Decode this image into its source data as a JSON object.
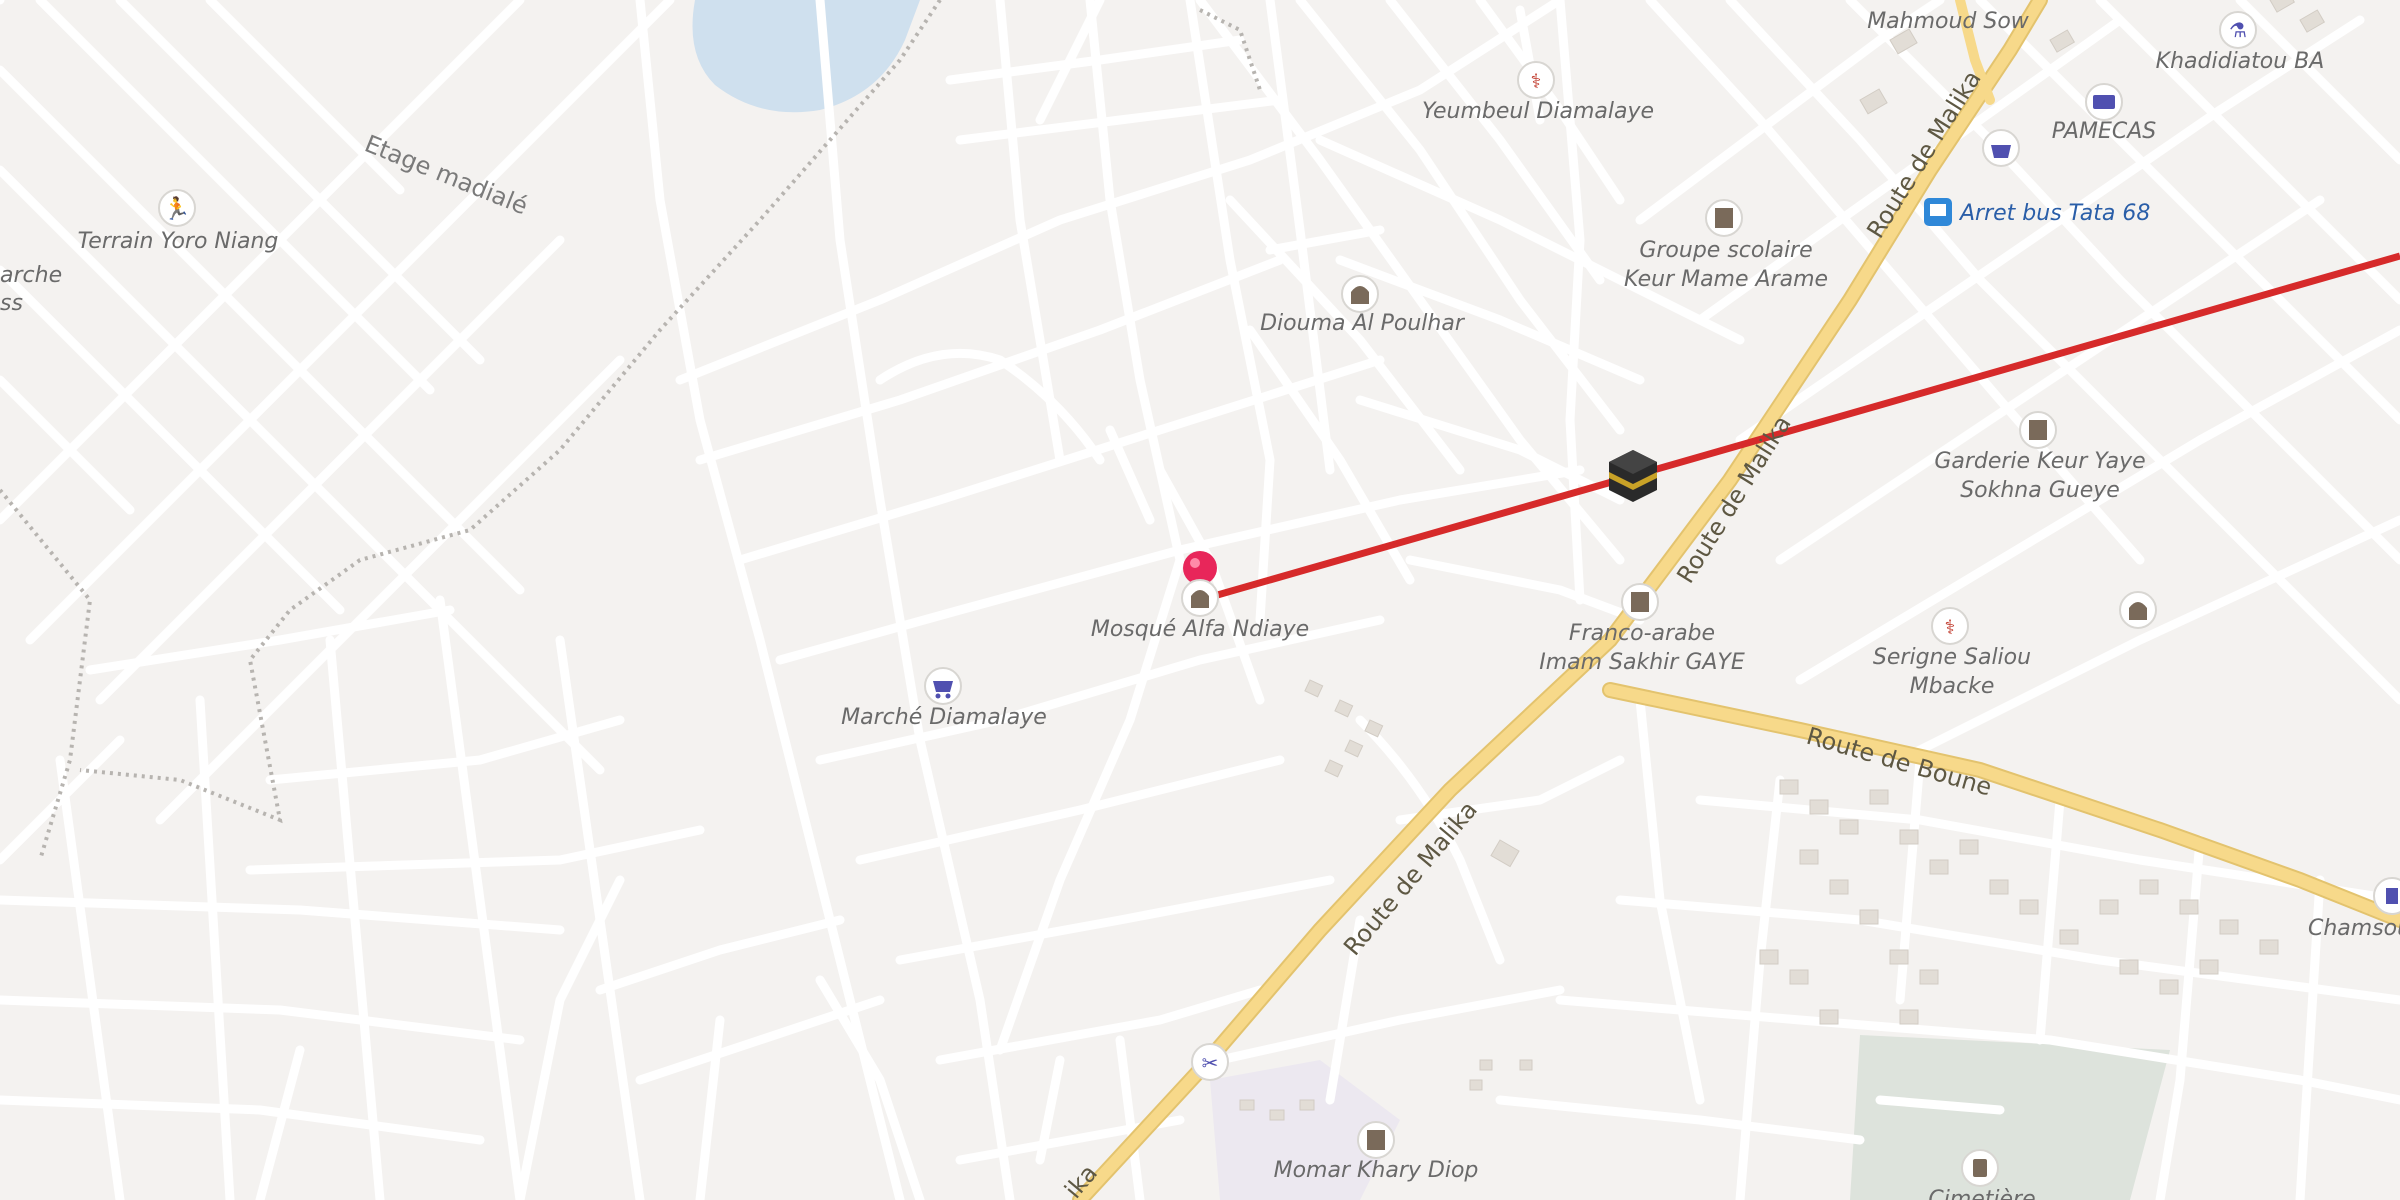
{
  "map": {
    "roads": {
      "route_de_malika_1": "Route de Malika",
      "route_de_malika_2": "Route de Malika",
      "route_de_malika_3": "Route de Malika",
      "route_de_malika_4": "ika",
      "route_de_boune": "Route de Boune",
      "etage_madiale": "Etage madialé"
    },
    "pois": {
      "terrain_yoro_niang": "Terrain Yoro Niang",
      "marche_partial_1": "arche",
      "marche_partial_2": "ss",
      "yeumbeul_diamalaye": "Yeumbeul Diamalaye",
      "mahmoud_sow": "Mahmoud Sow",
      "khadidiatou_ba": "Khadidiatou BA",
      "pamecas": "PAMECAS",
      "arret_bus": "Arret bus Tata 68",
      "groupe_scolaire_1": "Groupe scolaire",
      "groupe_scolaire_2": "Keur Mame Arame",
      "diouma_al_poulhar": "Diouma Al Poulhar",
      "garderie_1": "Garderie Keur Yaye",
      "garderie_2": "Sokhna Gueye",
      "mosque_alfa_ndiaye": "Mosqué Alfa Ndiaye",
      "franco_arabe_1": "Franco-arabe",
      "franco_arabe_2": "Imam Sakhir GAYE",
      "serigne_saliou_1": "Serigne Saliou",
      "serigne_saliou_2": "Mbacke",
      "marche_diamalaye": "Marché Diamalaye",
      "chamsou": "Chamsou",
      "momar_khary_diop": "Momar Khary Diop",
      "cimetiere": "Cimetière"
    },
    "colors": {
      "background": "#f4f2f0",
      "street": "#ffffff",
      "main_road": "#f7d98a",
      "water": "#cfe0ee",
      "qibla_line": "#d62a2a",
      "pin": "#e8265a",
      "poi_icon": "#5050b0",
      "health_icon": "#c0392b"
    },
    "icons": [
      "pin-icon",
      "kaaba-icon",
      "mosque-icon",
      "school-icon",
      "health-icon",
      "shopping-icon",
      "bank-icon",
      "bus-stop-icon",
      "pharmacy-icon",
      "scissors-icon",
      "cemetery-icon",
      "sport-icon"
    ]
  }
}
